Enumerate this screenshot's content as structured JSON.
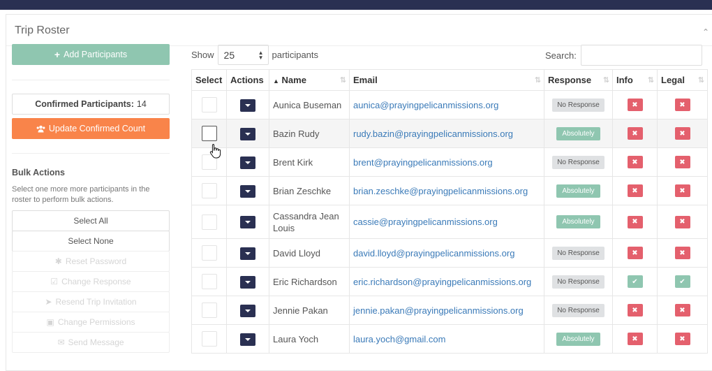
{
  "panel": {
    "title": "Trip Roster"
  },
  "sidebar": {
    "add_button": "Add Participants",
    "confirmed_label": "Confirmed Participants:",
    "confirmed_count": "14",
    "update_button": "Update Confirmed Count",
    "bulk_title": "Bulk Actions",
    "bulk_desc": "Select one more more participants in the roster to perform bulk actions.",
    "select_all": "Select All",
    "select_none": "Select None",
    "reset_password": "Reset Password",
    "change_response": "Change Response",
    "resend_invitation": "Resend Trip Invitation",
    "change_permissions": "Change Permissions",
    "send_message": "Send Message"
  },
  "controls": {
    "show_label": "Show",
    "page_size": "25",
    "participants_label": "participants",
    "search_label": "Search:"
  },
  "table": {
    "headers": {
      "select": "Select",
      "actions": "Actions",
      "name": "Name",
      "email": "Email",
      "response": "Response",
      "info": "Info",
      "legal": "Legal"
    },
    "rows": [
      {
        "name": "Aunica Buseman",
        "email": "aunica@prayingpelicanmissions.org",
        "response": "No Response"
      },
      {
        "name": "Bazin Rudy",
        "email": "rudy.bazin@prayingpelicanmissions.org",
        "response": "Absolutely"
      },
      {
        "name": "Brent Kirk",
        "email": "brent@prayingpelicanmissions.org",
        "response": "No Response"
      },
      {
        "name": "Brian Zeschke",
        "email": "brian.zeschke@prayingpelicanmissions.org",
        "response": "Absolutely"
      },
      {
        "name": "Cassandra Jean Louis",
        "email": "cassie@prayingpelicanmissions.org",
        "response": "Absolutely"
      },
      {
        "name": "David Lloyd",
        "email": "david.lloyd@prayingpelicanmissions.org",
        "response": "No Response"
      },
      {
        "name": "Eric Richardson",
        "email": "eric.richardson@prayingpelicanmissions.org",
        "response": "No Response"
      },
      {
        "name": "Jennie Pakan",
        "email": "jennie.pakan@prayingpelicanmissions.org",
        "response": "No Response"
      },
      {
        "name": "Laura Yoch",
        "email": "laura.yoch@gmail.com",
        "response": "Absolutely"
      }
    ]
  },
  "colors": {
    "navy": "#2a3052",
    "teal": "#8fc6b0",
    "orange": "#f9844a",
    "red": "#e4606d",
    "link": "#3a7ab8"
  }
}
